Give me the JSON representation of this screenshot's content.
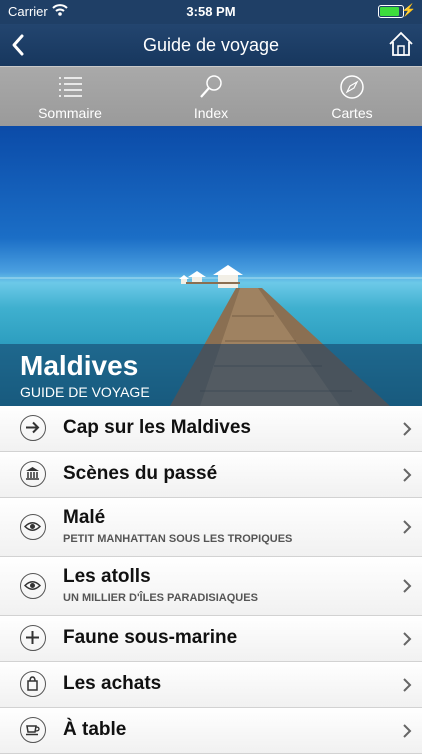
{
  "status_bar": {
    "carrier": "Carrier",
    "time": "3:58 PM",
    "battery_level": 0.95
  },
  "nav": {
    "title": "Guide de voyage"
  },
  "tabs": [
    {
      "label": "Sommaire",
      "icon": "list-icon"
    },
    {
      "label": "Index",
      "icon": "magnifier-icon"
    },
    {
      "label": "Cartes",
      "icon": "compass-icon"
    }
  ],
  "hero": {
    "title": "Maldives",
    "subtitle": "GUIDE DE VOYAGE"
  },
  "menu": [
    {
      "title": "Cap sur les Maldives",
      "subtitle": "",
      "icon": "arrow-icon"
    },
    {
      "title": "Scènes du passé",
      "subtitle": "",
      "icon": "monument-icon"
    },
    {
      "title": "Malé",
      "subtitle": "PETIT MANHATTAN SOUS LES TROPIQUES",
      "icon": "eye-icon"
    },
    {
      "title": "Les atolls",
      "subtitle": "UN MILLIER D'ÎLES PARADISIAQUES",
      "icon": "eye-icon"
    },
    {
      "title": "Faune sous-marine",
      "subtitle": "",
      "icon": "plus-icon"
    },
    {
      "title": "Les achats",
      "subtitle": "",
      "icon": "shopping-bag-icon"
    },
    {
      "title": "À table",
      "subtitle": "",
      "icon": "cup-icon"
    }
  ]
}
